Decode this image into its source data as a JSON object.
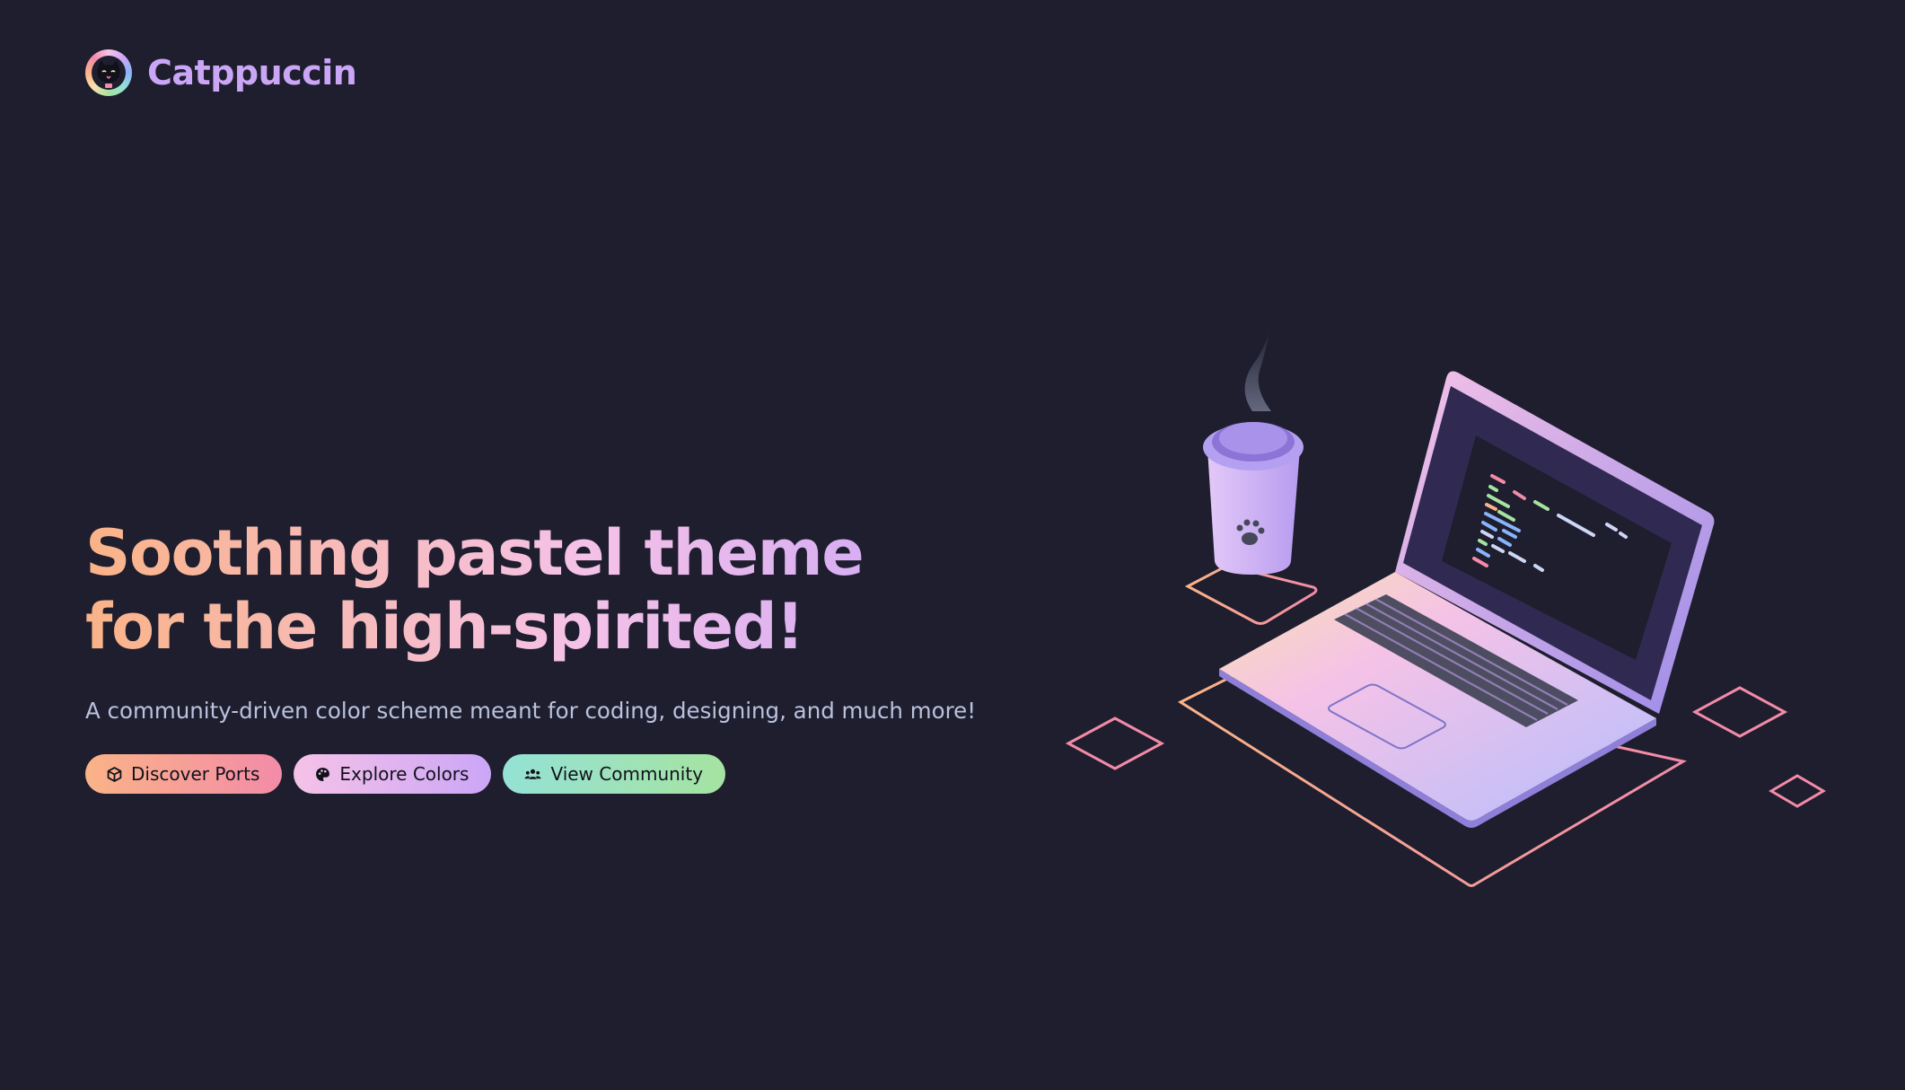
{
  "header": {
    "brand_name": "Catppuccin",
    "logo_icon": "cat-face-icon"
  },
  "hero": {
    "title_line_1": "Soothing pastel theme",
    "title_line_2": "for the high-spirited!",
    "subtitle": "A community-driven color scheme meant for coding, designing, and much more!",
    "buttons": [
      {
        "label": "Discover Ports",
        "icon": "cube-icon",
        "color_from": "#fab387",
        "color_to": "#f38ba8"
      },
      {
        "label": "Explore Colors",
        "icon": "palette-icon",
        "color_from": "#f5c2e7",
        "color_to": "#cba6f7"
      },
      {
        "label": "View Community",
        "icon": "people-icon",
        "color_from": "#94e2d5",
        "color_to": "#a6e3a1"
      }
    ]
  },
  "colors": {
    "background": "#1e1e2e",
    "brand": "#cba6f7",
    "subtitle": "#bac2de",
    "peach": "#fab387",
    "pink": "#f5c2e7",
    "mauve": "#cba6f7",
    "red": "#f38ba8",
    "teal": "#94e2d5",
    "green": "#a6e3a1"
  },
  "illustration": {
    "subject": "laptop-and-coffee-cup-illustration"
  }
}
